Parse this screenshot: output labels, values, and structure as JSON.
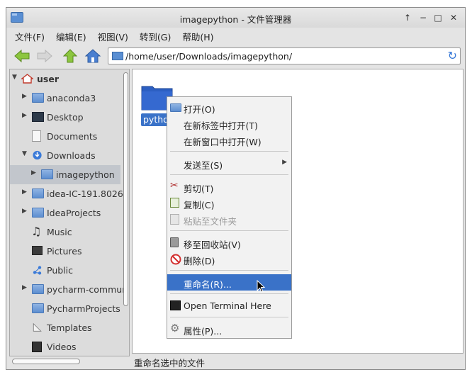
{
  "window": {
    "title": "imagepython - 文件管理器",
    "controls": [
      "↑",
      "−",
      "□",
      "✕"
    ]
  },
  "menubar": {
    "items": [
      "文件(F)",
      "编辑(E)",
      "视图(V)",
      "转到(G)",
      "帮助(H)"
    ]
  },
  "toolbar": {
    "address": "/home/user/Downloads/imagepython/"
  },
  "sidebar": {
    "items": [
      {
        "label": "user",
        "icon": "home-icon"
      },
      {
        "label": "anaconda3",
        "icon": "folder-icon"
      },
      {
        "label": "Desktop",
        "icon": "folder-icon"
      },
      {
        "label": "Documents",
        "icon": "document-icon"
      },
      {
        "label": "Downloads",
        "icon": "download-icon"
      },
      {
        "label": "imagepython",
        "icon": "folder-icon"
      },
      {
        "label": "idea-IC-191.8026",
        "icon": "folder-icon"
      },
      {
        "label": "IdeaProjects",
        "icon": "folder-icon"
      },
      {
        "label": "Music",
        "icon": "music-icon"
      },
      {
        "label": "Pictures",
        "icon": "pictures-icon"
      },
      {
        "label": "Public",
        "icon": "share-icon"
      },
      {
        "label": "pycharm-commun",
        "icon": "folder-icon"
      },
      {
        "label": "PycharmProjects",
        "icon": "folder-icon"
      },
      {
        "label": "Templates",
        "icon": "templates-icon"
      },
      {
        "label": "Videos",
        "icon": "video-icon"
      }
    ]
  },
  "main": {
    "file_label": "python"
  },
  "context_menu": {
    "open": "打开(O)",
    "open_tab": "在新标签中打开(T)",
    "open_window": "在新窗口中打开(W)",
    "send_to": "发送至(S)",
    "cut": "剪切(T)",
    "copy": "复制(C)",
    "paste_into": "粘贴至文件夹",
    "trash": "移至回收站(V)",
    "delete": "删除(D)",
    "rename": "重命名(R)...",
    "terminal": "Open Terminal Here",
    "properties": "属性(P)..."
  },
  "statusbar": {
    "text": "重命名选中的文件"
  },
  "colors": {
    "accent": "#3a72c8",
    "folder": "#5a8fd3"
  }
}
